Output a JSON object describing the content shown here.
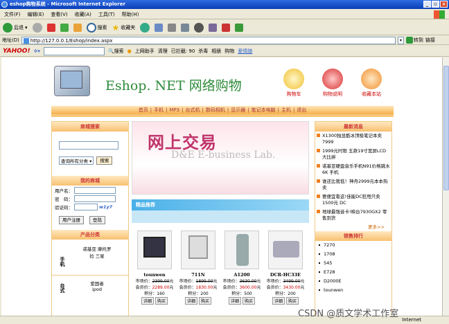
{
  "window": {
    "title": "eshop购物系统 - Microsoft Internet Explorer"
  },
  "menu": [
    "文件(F)",
    "编辑(E)",
    "查看(V)",
    "收藏(A)",
    "工具(T)",
    "帮助(H)"
  ],
  "toolbar": {
    "back": "后退",
    "search": "搜索",
    "favorites": "收藏夹"
  },
  "address": {
    "label": "地址(D)",
    "url": "http://127.0.0.1/Eshop/index.aspx",
    "go": "转到",
    "links": "链接"
  },
  "yahoo": {
    "logo": "YAHOO!",
    "search": "搜索",
    "online": "上网助手",
    "clean": "清理",
    "blocked": "已拦截: 90",
    "antivirus": "杀毒",
    "album": "相册",
    "shop": "购物",
    "mail": "爱情随"
  },
  "site": {
    "title": "Eshop. NET 网络购物",
    "header_buttons": [
      "购物车",
      "购物说明",
      "收藏本站"
    ],
    "nav": [
      "首页",
      "手机",
      "MP3",
      "台式机",
      "数码相机",
      "显示器",
      "笔记本电脑",
      "主机",
      "退出"
    ]
  },
  "left": {
    "search_head": "商城搜索",
    "category_select": "查询所有分类",
    "search_btn": "搜索",
    "mall_head": "我的商城",
    "username": "用户名：",
    "password": "密　码：",
    "captcha": "验证码：",
    "captcha_code": "w1y7",
    "register": "用户注册",
    "login": "登陆",
    "category_head": "产品分类",
    "cat1_label": "手机",
    "cat1_items": "诺基亚 摩托罗拉 三星",
    "cat2_label": "台式",
    "cat2_items": "爱国者 ipod"
  },
  "banner": {
    "main": "网上交易",
    "sub": "D&E E-business Lab."
  },
  "recommend": {
    "title": "精品推荐"
  },
  "products": [
    {
      "name": "tounwen",
      "market": "2399.00",
      "member": "2289.00",
      "points": "160"
    },
    {
      "name": "711N",
      "market": "1899.00",
      "member": "1830.00",
      "points": "200"
    },
    {
      "name": "A1200",
      "market": "3630.00",
      "member": "3600.00",
      "points": "500"
    },
    {
      "name": "DCR-HC33E",
      "market": "3499.00",
      "member": "3430.00",
      "points": "200"
    }
  ],
  "product_labels": {
    "market": "市场价：",
    "member": "会员价：",
    "yuan": "元",
    "points": "积分：",
    "detail": "详细",
    "buy": "购买"
  },
  "right": {
    "news_head": "最新消息",
    "news": [
      "X1300独显酷冰顶极笔记本卖7999",
      "1999元时限 五款19寸宽屏LCD大比拼",
      "诺基亚硬盘音乐手机N91价格跳水6K 手机",
      "谁还比我低！神舟2999元本本热卖",
      "要便宜看这!佳能DC狂甩只卖1500元 DC",
      "地球最强音卡!映台7930GX2 零售到货"
    ],
    "more": "更多>>",
    "rank_head": "销售排行",
    "rank": [
      "7270",
      "1708",
      "545",
      "E728",
      "D2000E",
      "tounwen"
    ]
  },
  "status": {
    "internet": "Internet"
  },
  "watermark": "CSDN @质文学术工作室"
}
